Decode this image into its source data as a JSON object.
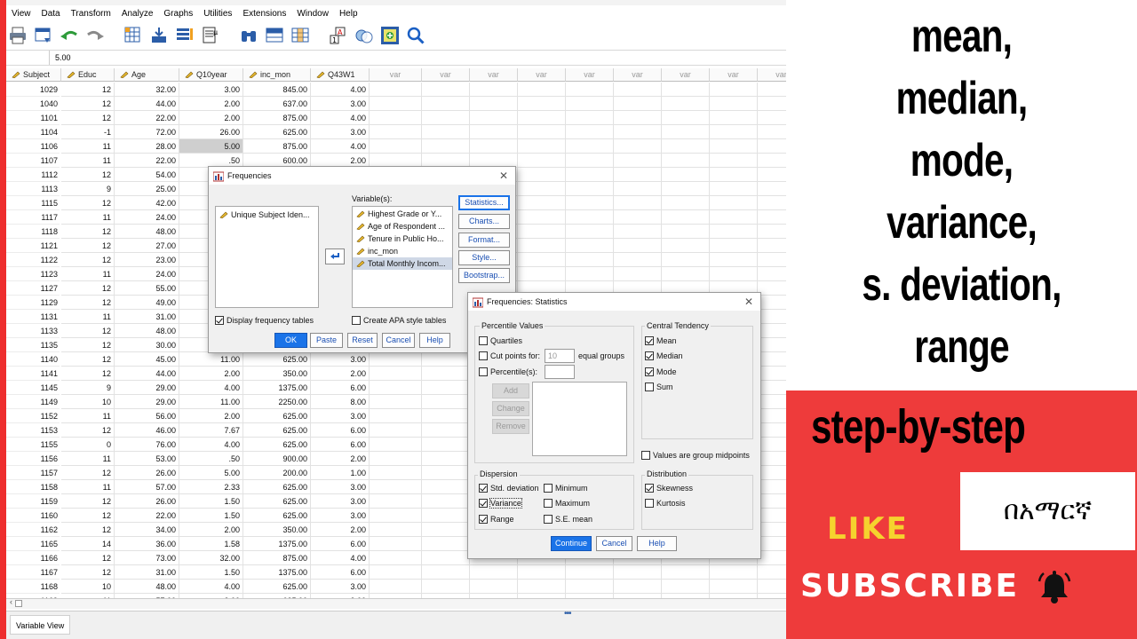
{
  "menu": [
    "View",
    "Data",
    "Transform",
    "Analyze",
    "Graphs",
    "Utilities",
    "Extensions",
    "Window",
    "Help"
  ],
  "cell_value": "5.00",
  "columns": [
    "Subject",
    "Educ",
    "Age",
    "Q10year",
    "inc_mon",
    "Q43W1"
  ],
  "var_label": "var",
  "var_columns_count": 9,
  "rows": [
    [
      "1029",
      "12",
      "32.00",
      "3.00",
      "845.00",
      "4.00"
    ],
    [
      "1040",
      "12",
      "44.00",
      "2.00",
      "637.00",
      "3.00"
    ],
    [
      "1101",
      "12",
      "22.00",
      "2.00",
      "875.00",
      "4.00"
    ],
    [
      "1104",
      "-1",
      "72.00",
      "26.00",
      "625.00",
      "3.00"
    ],
    [
      "1106",
      "11",
      "28.00",
      "5.00",
      "875.00",
      "4.00"
    ],
    [
      "1107",
      "11",
      "22.00",
      ".50",
      "600.00",
      "2.00"
    ],
    [
      "1112",
      "12",
      "54.00",
      "",
      "",
      ""
    ],
    [
      "1113",
      "9",
      "25.00",
      "",
      "",
      ""
    ],
    [
      "1115",
      "12",
      "42.00",
      "",
      "",
      ""
    ],
    [
      "1117",
      "11",
      "24.00",
      "",
      "",
      ""
    ],
    [
      "1118",
      "12",
      "48.00",
      "",
      "",
      ""
    ],
    [
      "1121",
      "12",
      "27.00",
      "",
      "",
      ""
    ],
    [
      "1122",
      "12",
      "23.00",
      "",
      "",
      ""
    ],
    [
      "1123",
      "11",
      "24.00",
      "",
      "",
      ""
    ],
    [
      "1127",
      "12",
      "55.00",
      "",
      "",
      ""
    ],
    [
      "1129",
      "12",
      "49.00",
      "",
      "",
      ""
    ],
    [
      "1131",
      "11",
      "31.00",
      "",
      "",
      ""
    ],
    [
      "1133",
      "12",
      "48.00",
      "",
      "",
      ""
    ],
    [
      "1135",
      "12",
      "30.00",
      "",
      "",
      ""
    ],
    [
      "1140",
      "12",
      "45.00",
      "11.00",
      "625.00",
      "3.00"
    ],
    [
      "1141",
      "12",
      "44.00",
      "2.00",
      "350.00",
      "2.00"
    ],
    [
      "1145",
      "9",
      "29.00",
      "4.00",
      "1375.00",
      "6.00"
    ],
    [
      "1149",
      "10",
      "29.00",
      "11.00",
      "2250.00",
      "8.00"
    ],
    [
      "1152",
      "11",
      "56.00",
      "2.00",
      "625.00",
      "3.00"
    ],
    [
      "1153",
      "12",
      "46.00",
      "7.67",
      "625.00",
      "6.00"
    ],
    [
      "1155",
      "0",
      "76.00",
      "4.00",
      "625.00",
      "6.00"
    ],
    [
      "1156",
      "11",
      "53.00",
      ".50",
      "900.00",
      "2.00"
    ],
    [
      "1157",
      "12",
      "26.00",
      "5.00",
      "200.00",
      "1.00"
    ],
    [
      "1158",
      "11",
      "57.00",
      "2.33",
      "625.00",
      "3.00"
    ],
    [
      "1159",
      "12",
      "26.00",
      "1.50",
      "625.00",
      "3.00"
    ],
    [
      "1160",
      "12",
      "22.00",
      "1.50",
      "625.00",
      "3.00"
    ],
    [
      "1162",
      "12",
      "34.00",
      "2.00",
      "350.00",
      "2.00"
    ],
    [
      "1165",
      "14",
      "36.00",
      "1.58",
      "1375.00",
      "6.00"
    ],
    [
      "1166",
      "12",
      "73.00",
      "32.00",
      "875.00",
      "4.00"
    ],
    [
      "1167",
      "12",
      "31.00",
      "1.50",
      "1375.00",
      "6.00"
    ],
    [
      "1168",
      "10",
      "48.00",
      "4.00",
      "625.00",
      "3.00"
    ],
    [
      "1169",
      "11",
      "57.00",
      "3.00",
      "625.00",
      "3.00"
    ]
  ],
  "bottom_tab": "Variable View",
  "freq": {
    "title": "Frequencies",
    "source_list": [
      "Unique Subject Iden..."
    ],
    "variables_label": "Variable(s):",
    "variables": [
      "Highest Grade or Y...",
      "Age of Respondent ...",
      "Tenure in Public Ho...",
      "inc_mon",
      "Total Monthly Incom..."
    ],
    "side_buttons": [
      "Statistics...",
      "Charts...",
      "Format...",
      "Style...",
      "Bootstrap..."
    ],
    "display_tables": "Display frequency tables",
    "apa": "Create APA style tables",
    "buttons": [
      "OK",
      "Paste",
      "Reset",
      "Cancel",
      "Help"
    ]
  },
  "stats": {
    "title": "Frequencies: Statistics",
    "percentile_title": "Percentile Values",
    "quartiles": "Quartiles",
    "cut_points": "Cut points for:",
    "cut_value": "10",
    "equal_groups": "equal groups",
    "percentiles": "Percentile(s):",
    "add": "Add",
    "change": "Change",
    "remove": "Remove",
    "central_title": "Central Tendency",
    "mean": "Mean",
    "median": "Median",
    "mode": "Mode",
    "sum": "Sum",
    "midpoints": "Values are group midpoints",
    "dispersion_title": "Dispersion",
    "std": "Std. deviation",
    "minimum": "Minimum",
    "variance": "Variance",
    "maximum": "Maximum",
    "range": "Range",
    "se_mean": "S.E. mean",
    "distribution_title": "Distribution",
    "skewness": "Skewness",
    "kurtosis": "Kurtosis",
    "buttons": [
      "Continue",
      "Cancel",
      "Help"
    ]
  },
  "promo": {
    "lines": [
      "mean,",
      "median,",
      "mode,",
      "variance,",
      "s. deviation,",
      "range"
    ],
    "step": "step-by-step",
    "amharic": "በአማርኛ",
    "like": "LIKE",
    "subscribe": "SUBSCRIBE"
  },
  "colors": {
    "accent": "#1a73e8",
    "promo_red": "#ee3b3b",
    "like_yellow": "#f5d22e"
  }
}
